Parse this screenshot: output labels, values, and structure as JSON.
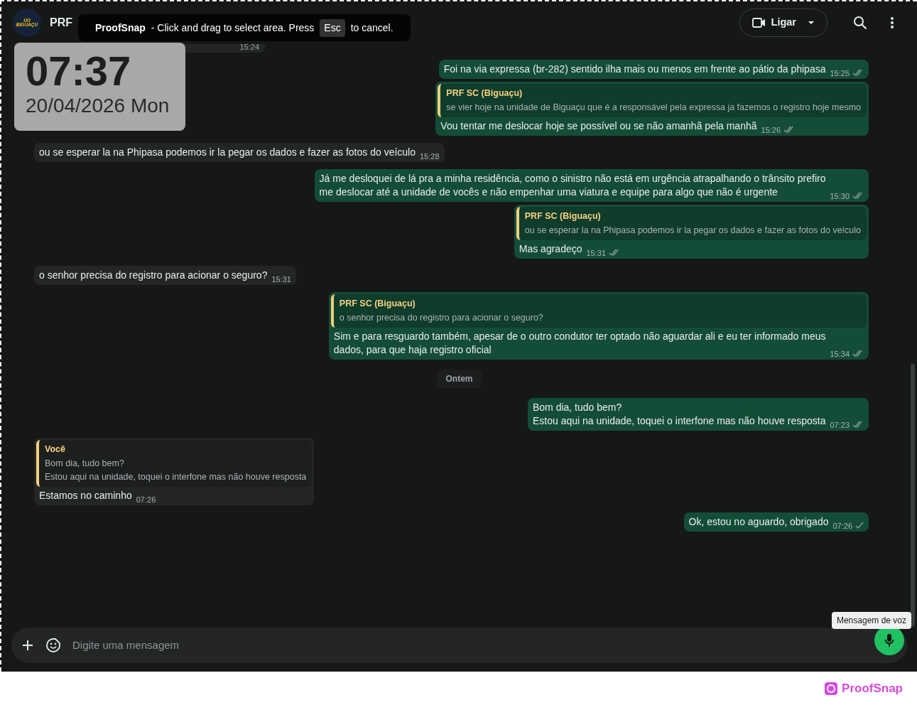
{
  "overlay_toast": {
    "brand": "ProofSnap",
    "text": "- Click and drag to select area. Press",
    "key": "Esc",
    "text_after": "to cancel."
  },
  "clock_widget": {
    "time": "07:37",
    "date": "20/04/2026 Mon"
  },
  "header": {
    "avatar_lines": [
      "UO",
      "BIGUAÇU"
    ],
    "title": "PRF",
    "call_button": "Ligar"
  },
  "messages": [
    {
      "kind": "partial",
      "time": "15:24"
    },
    {
      "kind": "outgoing",
      "text": "Foi na via expressa (br-282) sentido ilha mais ou menos em frente ao pátio da phipasa",
      "time": "15:25",
      "read": true
    },
    {
      "kind": "outgoing",
      "quote": {
        "author": "PRF SC (Biguaçu)",
        "text": "se vier hoje na unidade de Biguaçu que é a responsável pela expressa ja fazemos o registro hoje mesmo"
      },
      "text": "Vou tentar me deslocar hoje se possível ou se não amanhã pela manhã",
      "time": "15:26",
      "read": true
    },
    {
      "kind": "incoming",
      "text": "ou se esperar la na Phipasa podemos ir la pegar os dados e fazer as fotos do veículo",
      "time": "15:28"
    },
    {
      "kind": "outgoing",
      "text": "Já me desloquei de lá pra a minha residência, como o sinistro não está em urgência atrapalhando o trânsito prefiro\nme deslocar até a unidade de vocês e não empenhar uma viatura e equipe para algo que não é urgente",
      "time": "15:30",
      "read": true
    },
    {
      "kind": "outgoing",
      "quote": {
        "author": "PRF SC (Biguaçu)",
        "text": "ou se esperar la na Phipasa podemos ir la pegar os dados e fazer as fotos do veículo"
      },
      "text": "Mas agradeço",
      "time": "15:31",
      "read": true
    },
    {
      "kind": "incoming",
      "text": "o senhor precisa do registro para acionar o seguro?",
      "time": "15:31"
    },
    {
      "kind": "outgoing",
      "quote": {
        "author": "PRF SC (Biguaçu)",
        "text": "o senhor precisa do registro para acionar o seguro?"
      },
      "text": "Sim e para resguardo também, apesar de o outro condutor ter optado não aguardar ali e eu ter informado meus\ndados, para que haja registro oficial",
      "time": "15:34",
      "read": true
    },
    {
      "kind": "divider",
      "text": "Ontem"
    },
    {
      "kind": "outgoing",
      "text": "Bom dia, tudo bem?\nEstou aqui na unidade, toquei o interfone mas não houve resposta",
      "time": "07:23",
      "read": true
    },
    {
      "kind": "incoming",
      "quote": {
        "author": "Você",
        "text": "Bom dia, tudo bem?\nEstou aqui na unidade, toquei o interfone mas não houve resposta"
      },
      "text": "Estamos no caminho",
      "time": "07:26"
    },
    {
      "kind": "outgoing",
      "text": "Ok, estou no aguardo, obrigado",
      "time": "07:26",
      "read": false
    }
  ],
  "composer": {
    "placeholder": "Digite uma mensagem"
  },
  "tooltip": "Mensagem de voz",
  "footer_brand": "ProofSnap"
}
